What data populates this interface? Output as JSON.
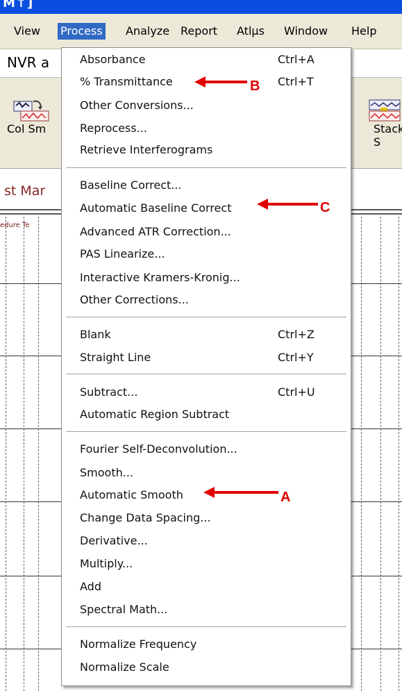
{
  "window": {
    "title_fragment": "M↑]"
  },
  "menubar": {
    "items": [
      "View",
      "Process",
      "Analyze",
      "Report",
      "Atlµs",
      "Window",
      "Help"
    ],
    "active": "Process"
  },
  "address": {
    "text": "NVR a"
  },
  "toolbar": {
    "left_label": "Col Sm",
    "right_label": "Stack S"
  },
  "tab": {
    "text": "st Mar"
  },
  "plot": {
    "header_fragment": "edure Te"
  },
  "menu": {
    "items": [
      {
        "label": "Absorbance",
        "shortcut": "Ctrl+A"
      },
      {
        "label": "% Transmittance",
        "shortcut": "Ctrl+T"
      },
      {
        "label": "Other Conversions...",
        "shortcut": ""
      },
      {
        "label": "Reprocess...",
        "shortcut": ""
      },
      {
        "label": "Retrieve Interferograms",
        "shortcut": ""
      },
      {
        "label": "Baseline Correct...",
        "shortcut": ""
      },
      {
        "label": "Automatic Baseline Correct",
        "shortcut": ""
      },
      {
        "label": "Advanced ATR Correction...",
        "shortcut": ""
      },
      {
        "label": "PAS Linearize...",
        "shortcut": ""
      },
      {
        "label": "Interactive Kramers-Kronig...",
        "shortcut": ""
      },
      {
        "label": "Other Corrections...",
        "shortcut": ""
      },
      {
        "label": "Blank",
        "shortcut": "Ctrl+Z"
      },
      {
        "label": "Straight Line",
        "shortcut": "Ctrl+Y"
      },
      {
        "label": "Subtract...",
        "shortcut": "Ctrl+U"
      },
      {
        "label": "Automatic Region Subtract",
        "shortcut": ""
      },
      {
        "label": "Fourier Self-Deconvolution...",
        "shortcut": ""
      },
      {
        "label": "Smooth...",
        "shortcut": ""
      },
      {
        "label": "Automatic Smooth",
        "shortcut": ""
      },
      {
        "label": "Change Data Spacing...",
        "shortcut": ""
      },
      {
        "label": "Derivative...",
        "shortcut": ""
      },
      {
        "label": "Multiply...",
        "shortcut": ""
      },
      {
        "label": "Add",
        "shortcut": ""
      },
      {
        "label": "Spectral Math...",
        "shortcut": ""
      },
      {
        "label": "Normalize Frequency",
        "shortcut": ""
      },
      {
        "label": "Normalize Scale",
        "shortcut": ""
      }
    ]
  },
  "annotations": [
    {
      "label": "B",
      "target": "% Transmittance"
    },
    {
      "label": "C",
      "target": "Automatic Baseline Correct"
    },
    {
      "label": "A",
      "target": "Automatic Smooth"
    }
  ],
  "colors": {
    "accent": "#316ac5",
    "titlebar": "#0a4ee0",
    "annotation": "#e00000",
    "menubar": "#ece9d8"
  }
}
